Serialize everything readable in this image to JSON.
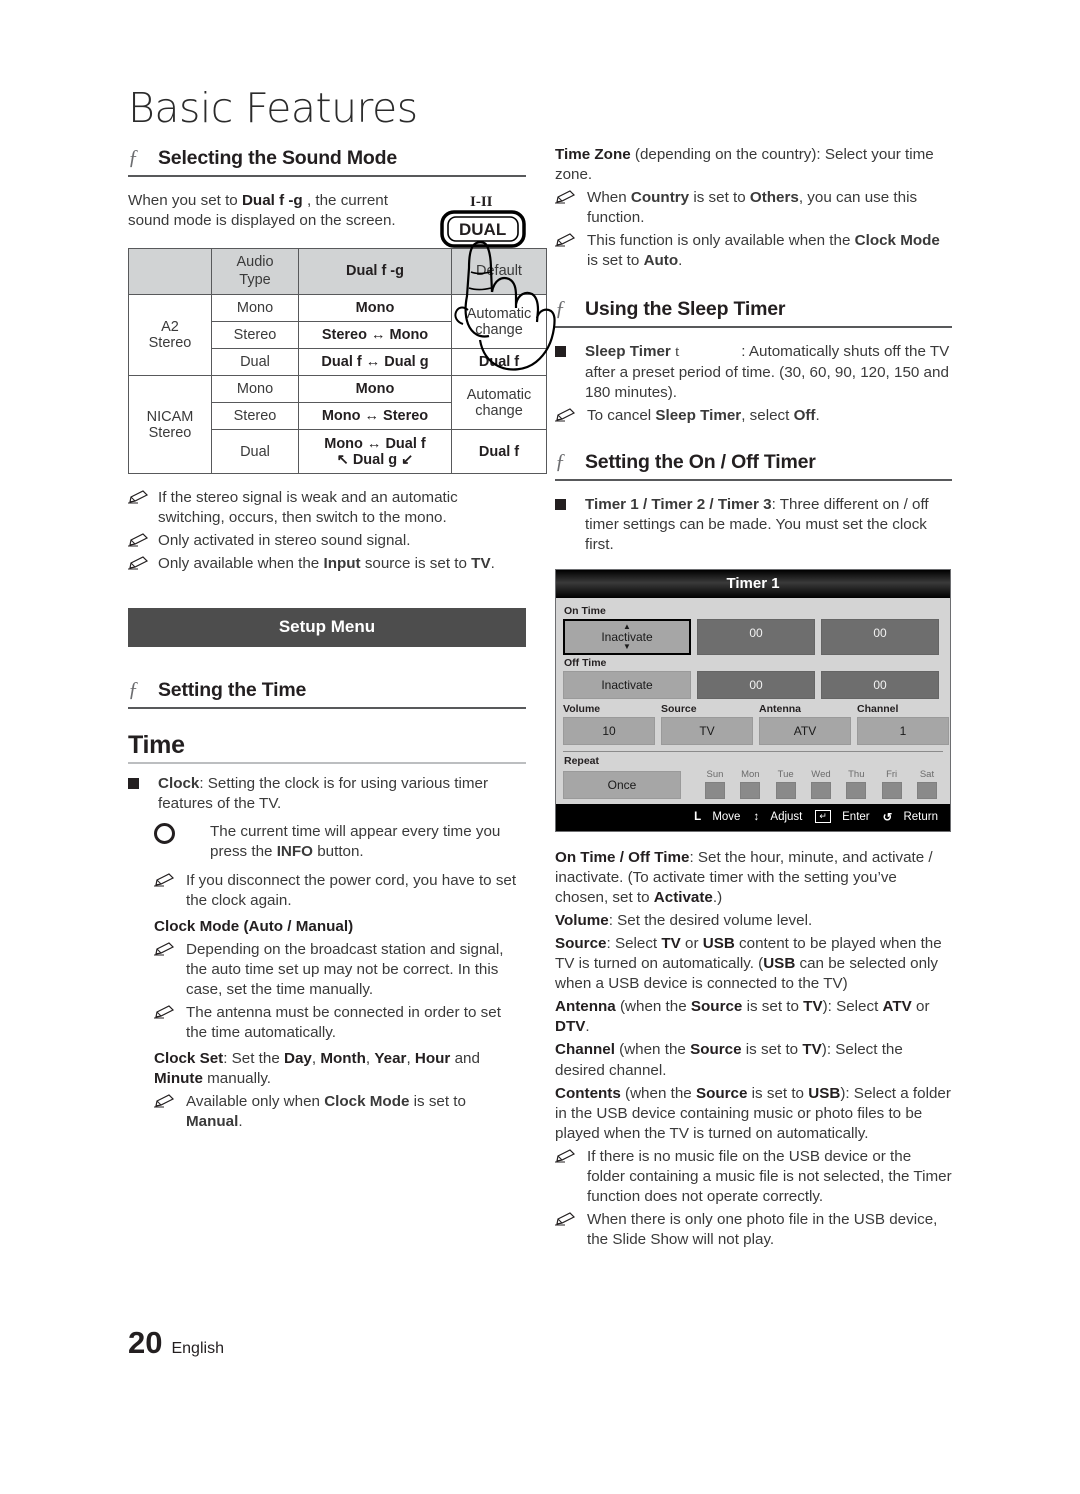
{
  "page": {
    "title": "Basic Features",
    "number": "20",
    "language": "English"
  },
  "left": {
    "sound_mode": {
      "heading": "Selecting the Sound Mode",
      "intro_1": "When you set to ",
      "intro_bold": "Dual f -g",
      "intro_2": " , the current sound mode is displayed on the screen.",
      "remote": {
        "top_label": "I-II",
        "button_label": "DUAL"
      }
    },
    "audio_table": {
      "headers": [
        "",
        "Audio Type",
        "Dual f -g",
        "Default"
      ],
      "rows": [
        {
          "group": "A2 Stereo",
          "type": "Mono",
          "dual": "Mono",
          "default": "Automatic change"
        },
        {
          "group": "",
          "type": "Stereo",
          "dual": "Stereo ↔ Mono",
          "default": ""
        },
        {
          "group": "",
          "type": "Dual",
          "dual": "Dual f ↔ Dual g",
          "default": "Dual f"
        },
        {
          "group": "NICAM Stereo",
          "type": "Mono",
          "dual": "Mono",
          "default": "Automatic change"
        },
        {
          "group": "",
          "type": "Stereo",
          "dual": "Mono ↔ Stereo",
          "default": ""
        },
        {
          "group": "",
          "type": "Dual",
          "dual": "Mono ↔ Dual f",
          "dual2": "↖ Dual g ↙",
          "default": "Dual f"
        }
      ]
    },
    "sound_notes": [
      "If the stereo signal is weak and an automatic switching, occurs, then switch to the mono.",
      "Only activated in stereo sound signal.",
      "Only available when the Input source is set to TV."
    ],
    "banner": "Setup Menu",
    "time": {
      "heading": "Setting the Time",
      "big_head": "Time",
      "clock_label": "Clock",
      "clock_text": ": Setting the clock is for using various timer features of the TV.",
      "info_note": "The current time will appear every time you press the INFO button.",
      "disconnect_note": "If you disconnect the power cord, you have to set the clock again.",
      "clock_mode_head": "Clock Mode (Auto / Manual)",
      "clock_mode_note_1": "Depending on the broadcast station and signal, the auto time set up may not be correct. In this case, set the time manually.",
      "clock_mode_note_2": "The antenna must be connected in order to set the time automatically.",
      "clock_set_label": "Clock Set",
      "clock_set_text": ": Set the Day, Month, Year, Hour and Minute manually.",
      "clock_set_note": "Available only when Clock Mode is set to Manual."
    }
  },
  "right": {
    "time_zone": {
      "label": "Time Zone",
      "text": " (depending on the country): Select your time zone.",
      "note_1": "When Country is set to Others, you can use this function.",
      "note_2": "This function is only available when the Clock Mode is set to Auto."
    },
    "sleep_timer": {
      "heading": "Using the Sleep Timer",
      "label": "Sleep Timer",
      "glyph": "t",
      "text": ": Automatically shuts off the TV after a preset period of time. (30, 60, 90, 120, 150 and 180 minutes).",
      "note": "To cancel Sleep Timer, select Off."
    },
    "on_off_timer": {
      "heading": "Setting the On / Off Timer",
      "label": "Timer 1 / Timer 2 / Timer 3",
      "text": ": Three different on / off timer settings can be made. You must set the clock first."
    },
    "osd": {
      "title": "Timer 1",
      "on_time_label": "On Time",
      "on_time_value": "Inactivate",
      "on_time_hour": "00",
      "on_time_minute": "00",
      "off_time_label": "Off Time",
      "off_time_value": "Inactivate",
      "off_time_hour": "00",
      "off_time_minute": "00",
      "quad_labels": [
        "Volume",
        "Source",
        "Antenna",
        "Channel"
      ],
      "quad_values": [
        "10",
        "TV",
        "ATV",
        "1"
      ],
      "repeat_label": "Repeat",
      "repeat_value": "Once",
      "days": [
        "Sun",
        "Mon",
        "Tue",
        "Wed",
        "Thu",
        "Fri",
        "Sat"
      ],
      "footer": [
        {
          "key": "L",
          "action": "Move"
        },
        {
          "key": "↕",
          "action": "Adjust"
        },
        {
          "key": "↵",
          "action": "Enter"
        },
        {
          "key": "↺",
          "action": "Return"
        }
      ]
    },
    "descriptions": {
      "on_off_time_label": "On Time / Off Time",
      "on_off_time_text": ": Set the hour, minute, and activate / inactivate. (To activate timer with the setting you’ve chosen, set to Activate.)",
      "volume_label": "Volume",
      "volume_text": ": Set the desired volume level.",
      "source_label": "Source",
      "source_text": ": Select TV or USB content to be played when the TV is turned on automatically. (USB can be selected only when a USB device is connected to the TV)",
      "antenna_label": "Antenna",
      "antenna_text": " (when the Source is set to TV): Select ATV or DTV.",
      "channel_label": "Channel",
      "channel_text": " (when the Source is set to TV): Select the desired channel.",
      "contents_label": "Contents",
      "contents_text": " (when the Source is set to USB): Select a folder in the USB device containing music or photo files to be played when the TV is turned on automatically.",
      "note_1": "If there is no music file on the USB device or the folder containing a music file is not selected, the Timer function does not operate correctly.",
      "note_2": "When there is only one photo file in the USB device, the Slide Show will not play."
    }
  }
}
